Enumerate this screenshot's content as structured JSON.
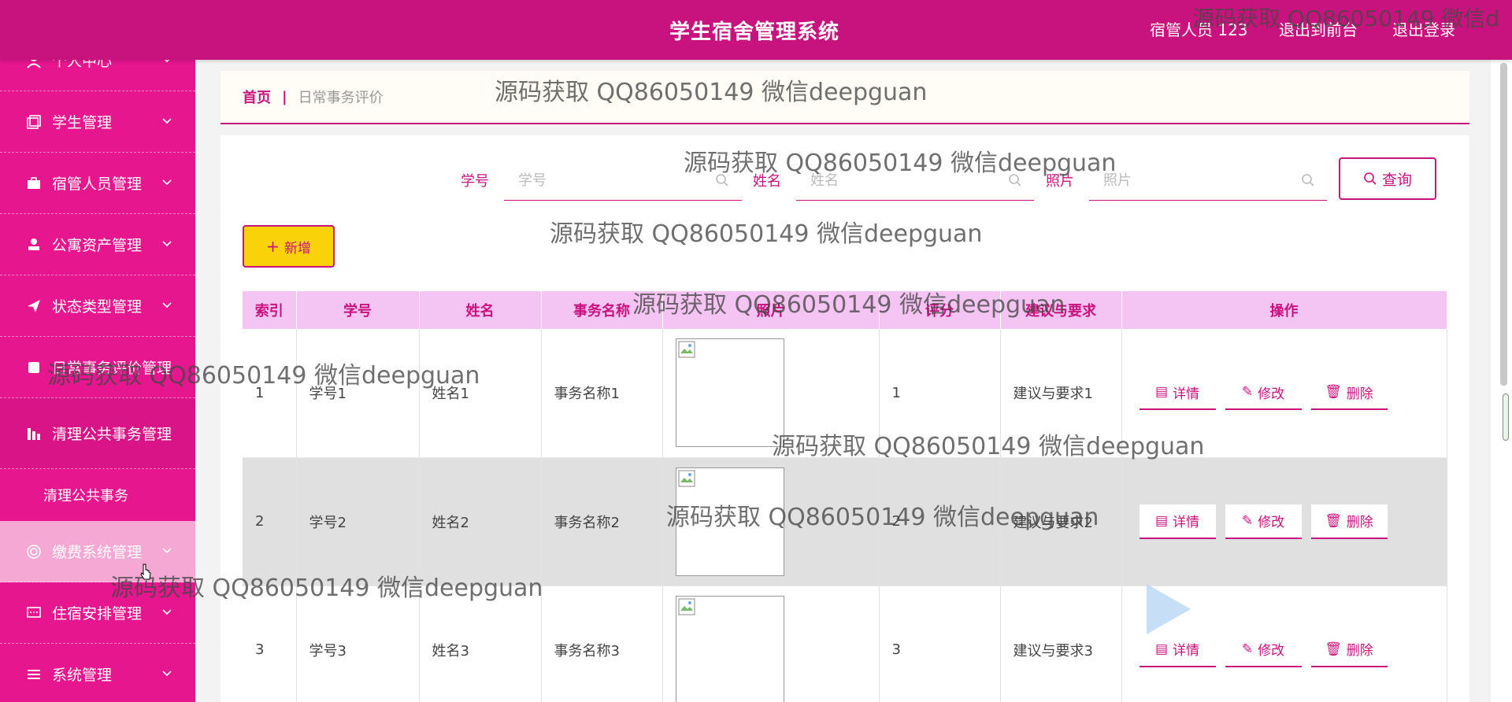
{
  "header": {
    "title": "学生宿舍管理系统",
    "user": "宿管人员 123",
    "to_front": "退出到前台",
    "logout": "退出登录"
  },
  "sidebar": {
    "items": [
      {
        "label": "个人中心",
        "icon": "person-icon"
      },
      {
        "label": "学生管理",
        "icon": "copy-icon"
      },
      {
        "label": "宿管人员管理",
        "icon": "briefcase-icon"
      },
      {
        "label": "公寓资产管理",
        "icon": "stamp-icon"
      },
      {
        "label": "状态类型管理",
        "icon": "send-icon"
      },
      {
        "label": "日常事务评价管理",
        "icon": "book-icon"
      },
      {
        "label": "清理公共事务管理",
        "icon": "chart-icon"
      },
      {
        "label": "缴费系统管理",
        "icon": "help-icon"
      },
      {
        "label": "住宿安排管理",
        "icon": "chat-icon"
      },
      {
        "label": "系统管理",
        "icon": "list-icon"
      }
    ],
    "sub_item": "清理公共事务"
  },
  "breadcrumb": {
    "home": "首页",
    "separator": "|",
    "current": "日常事务评价"
  },
  "search": {
    "fields": [
      {
        "label": "学号",
        "placeholder": "学号"
      },
      {
        "label": "姓名",
        "placeholder": "姓名"
      },
      {
        "label": "照片",
        "placeholder": "照片"
      }
    ],
    "query_label": "查询"
  },
  "toolbar": {
    "add_label": "新增"
  },
  "table": {
    "columns": [
      "索引",
      "学号",
      "姓名",
      "事务名称",
      "照片",
      "评分",
      "建议与要求",
      "操作"
    ],
    "rows": [
      {
        "index": "1",
        "student_no": "学号1",
        "name": "姓名1",
        "affair": "事务名称1",
        "score": "1",
        "advice": "建议与要求1"
      },
      {
        "index": "2",
        "student_no": "学号2",
        "name": "姓名2",
        "affair": "事务名称2",
        "score": "2",
        "advice": "建议与要求2"
      },
      {
        "index": "3",
        "student_no": "学号3",
        "name": "姓名3",
        "affair": "事务名称3",
        "score": "3",
        "advice": "建议与要求3"
      }
    ],
    "actions": {
      "detail": "详情",
      "edit": "修改",
      "delete": "删除"
    }
  },
  "watermark": "源码获取 QQ86050149 微信deepguan",
  "watermark_partial": "源码获取 QQ86050149 微信d",
  "colors": {
    "accent": "#c8137e",
    "sidebar": "#e6168f",
    "table_header": "#f4c4f3",
    "add_button": "#f9d20a"
  }
}
